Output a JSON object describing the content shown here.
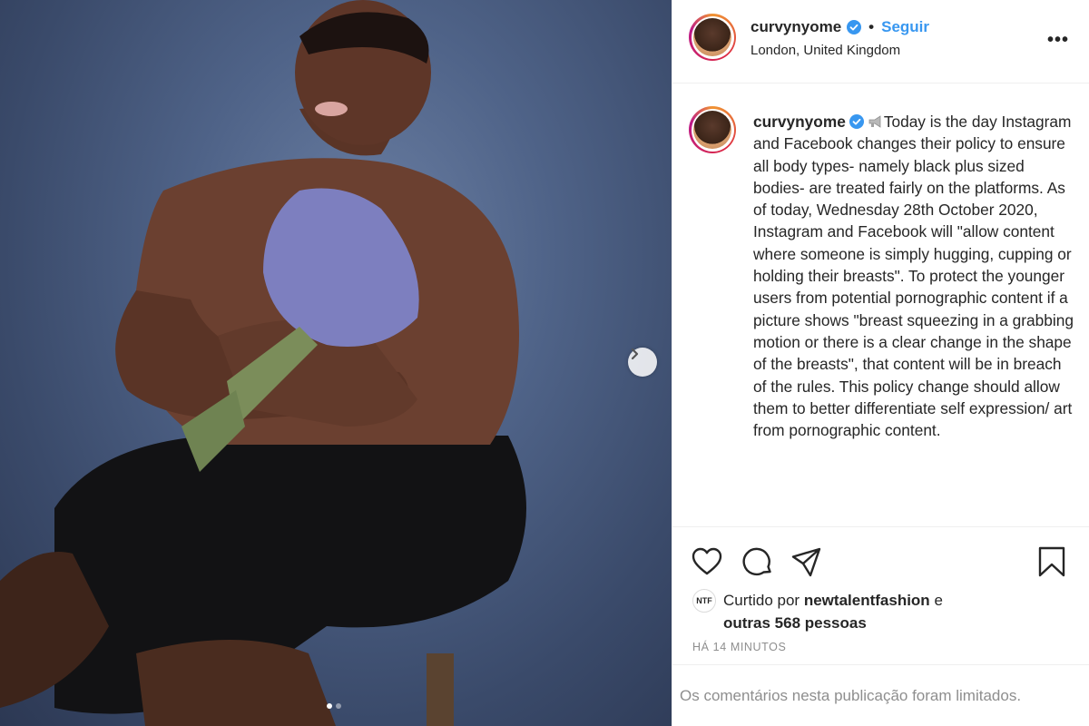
{
  "post": {
    "username": "curvynyome",
    "separator": "•",
    "follow_label": "Seguir",
    "location": "London, United Kingdom",
    "more_label": "•••"
  },
  "caption": {
    "username": "curvynyome",
    "text": "Today is the day Instagram and Facebook changes their policy to ensure all body types- namely black plus sized bodies- are treated fairly on the platforms. As of today, Wednesday 28th October 2020, Instagram and Facebook will \"allow content where someone is simply hugging, cupping or holding their breasts\". To protect the younger users from potential pornographic content if a picture shows \"breast squeezing in a grabbing motion or there is a clear change in the shape of the breasts\", that content will be in breach of the rules. This policy change should allow them to better differentiate self expression/ art from pornographic content."
  },
  "likes": {
    "liker_avatar_text": "NTF",
    "prefix": "Curtido por",
    "liker": "newtalentfashion",
    "connector": "e",
    "others": "outras 568 pessoas"
  },
  "timestamp": "HÁ 14 MINUTOS",
  "comments_notice": "Os comentários nesta publicação foram limitados.",
  "carousel": {
    "total": 2,
    "current": 1
  },
  "icons": [
    "heart-icon",
    "comment-icon",
    "share-icon",
    "bookmark-icon",
    "verified-badge-icon",
    "megaphone-icon",
    "chevron-right-icon"
  ],
  "colors": {
    "follow": "#3897f0",
    "verified": "#3897f0",
    "muted": "#8e8e8e"
  }
}
